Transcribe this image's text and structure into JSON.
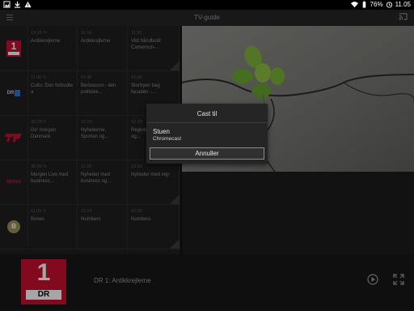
{
  "status_bar": {
    "battery": "76%",
    "time": "11.05"
  },
  "app_bar": {
    "title": "TV-guide"
  },
  "guide": {
    "rows": [
      {
        "channel": "DR1",
        "logo_text": "1",
        "programs": [
          {
            "time": "10.25",
            "title": "Antikkrejlerne",
            "rerun": true
          },
          {
            "time": "11.16",
            "title": "Antikkrejlerne",
            "rerun": false
          },
          {
            "time": "11.55",
            "title": "Vild håndbold: Cameroun-...",
            "rerun": false
          }
        ]
      },
      {
        "channel": "DR2",
        "logo_text": "DR 2",
        "programs": [
          {
            "time": "11.00",
            "title": "Cultu: Den forbudte a",
            "rerun": true
          },
          {
            "time": "11.40",
            "title": "Berlusconi - den politiske...",
            "rerun": false
          },
          {
            "time": "12.40",
            "title": "Storbyen bag facaden -...",
            "rerun": false
          }
        ]
      },
      {
        "channel": "TV2",
        "logo_text": "TV2",
        "programs": [
          {
            "time": "06.00",
            "title": "Go' morgen Danmark",
            "rerun": true
          },
          {
            "time": "12.00",
            "title": "Nyhederne, Sporten og...",
            "rerun": false
          },
          {
            "time": "12.20",
            "title": "Regionale nyheder og...",
            "rerun": false
          }
        ]
      },
      {
        "channel": "TV2 News",
        "logo_text": "News",
        "programs": [
          {
            "time": "06.00",
            "title": "Morgen Live med business...",
            "rerun": true
          },
          {
            "time": "11.00",
            "title": "Nyheder med business og...",
            "rerun": false
          },
          {
            "time": "13.00",
            "title": "Nyheder med vejr",
            "rerun": false
          }
        ]
      },
      {
        "channel": "Boomerang",
        "logo_text": "B",
        "programs": [
          {
            "time": "11.00",
            "title": "Bones",
            "rerun": true
          },
          {
            "time": "12.00",
            "title": "Numbers",
            "rerun": false
          },
          {
            "time": "12.05",
            "title": "Numbers",
            "rerun": false
          }
        ]
      }
    ]
  },
  "dialog": {
    "title": "Cast til",
    "device_name": "Stuen",
    "device_type": "Chromecast",
    "cancel_label": "Annuller"
  },
  "player": {
    "thumb_number": "1",
    "thumb_brand": "DR",
    "now_playing": "DR 1: Antikkrejlerne"
  },
  "colors": {
    "dr_red": "#c6102e",
    "dialog_bg": "#252525",
    "accent": "#ffffff"
  }
}
